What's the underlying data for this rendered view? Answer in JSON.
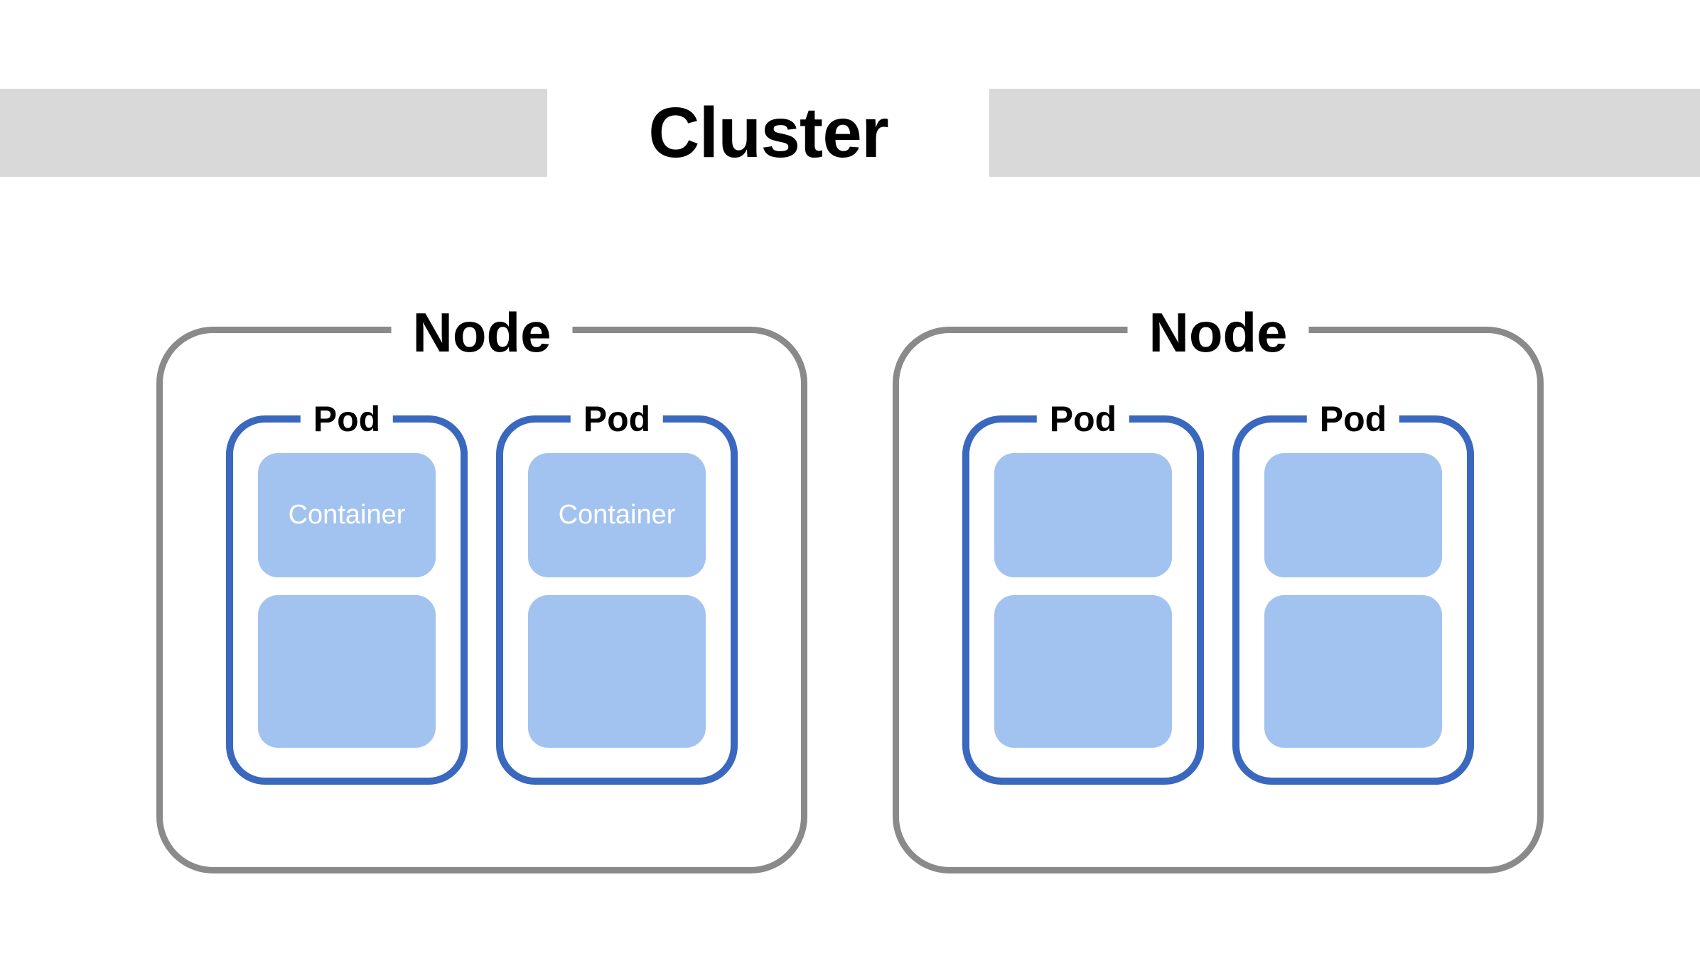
{
  "diagram": {
    "title": "Cluster",
    "nodes": [
      {
        "label": "Node",
        "pods": [
          {
            "label": "Pod",
            "containers": [
              {
                "label": "Container"
              },
              {
                "label": ""
              }
            ]
          },
          {
            "label": "Pod",
            "containers": [
              {
                "label": "Container"
              },
              {
                "label": ""
              }
            ]
          }
        ]
      },
      {
        "label": "Node",
        "pods": [
          {
            "label": "Pod",
            "containers": [
              {
                "label": ""
              },
              {
                "label": ""
              }
            ]
          },
          {
            "label": "Pod",
            "containers": [
              {
                "label": ""
              },
              {
                "label": ""
              }
            ]
          }
        ]
      }
    ]
  }
}
